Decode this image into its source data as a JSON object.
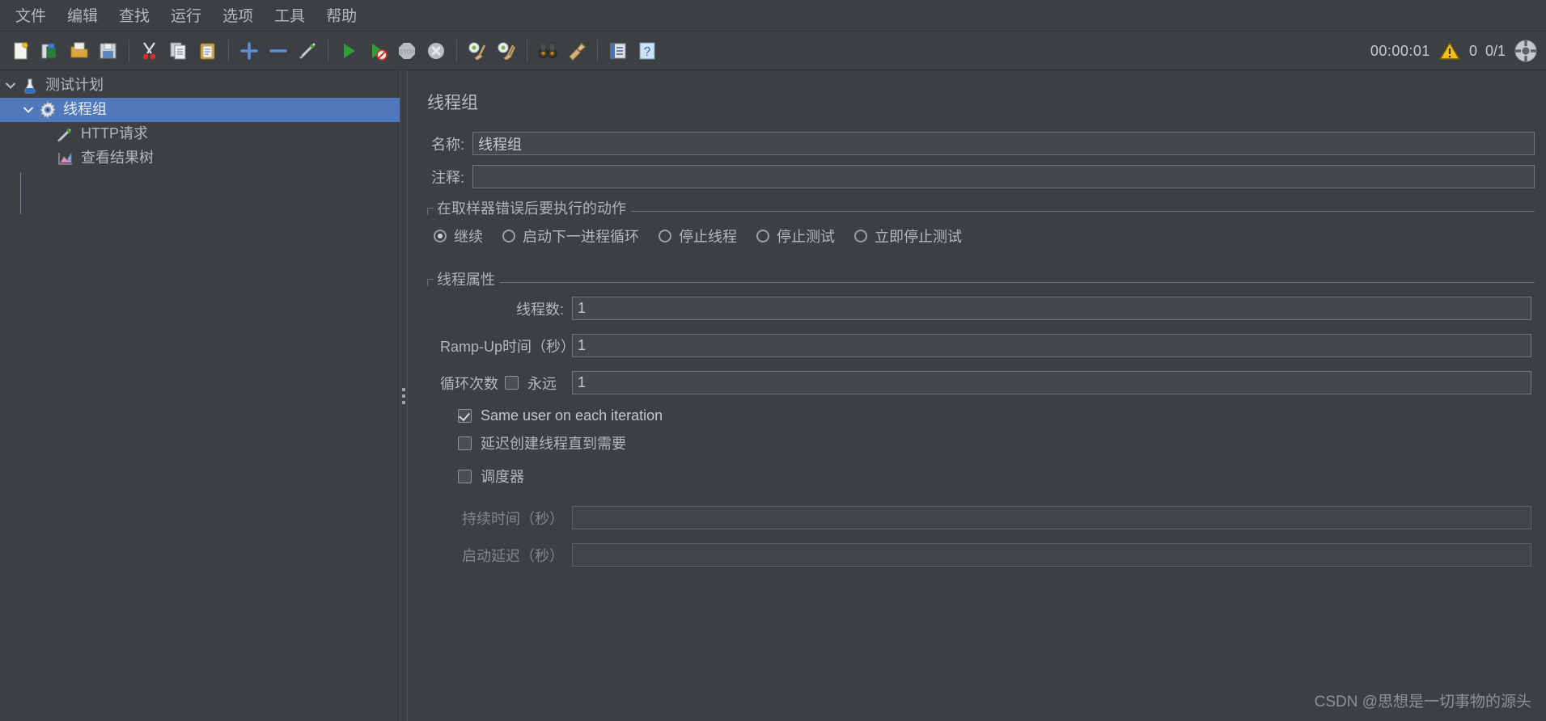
{
  "window": {
    "theme_bg": "#3c4043",
    "accent_selection": "#5079bd",
    "text_color": "#b5b8ba"
  },
  "menubar": {
    "items": [
      {
        "label": "文件",
        "name": "menu-file"
      },
      {
        "label": "编辑",
        "name": "menu-edit"
      },
      {
        "label": "查找",
        "name": "menu-search"
      },
      {
        "label": "运行",
        "name": "menu-run"
      },
      {
        "label": "选项",
        "name": "menu-options"
      },
      {
        "label": "工具",
        "name": "menu-tools"
      },
      {
        "label": "帮助",
        "name": "menu-help"
      }
    ]
  },
  "toolbar": {
    "icons": [
      "new-document-icon",
      "templates-icon",
      "open-folder-icon",
      "save-disk-icon",
      "cut-scissors-icon",
      "copy-icon",
      "paste-clipboard-icon",
      "add-plus-icon",
      "remove-minus-icon",
      "toggle-pen-icon",
      "start-play-icon",
      "start-no-pauses-icon",
      "stop-icon",
      "shutdown-icon",
      "clear-gear-icon",
      "clear-all-gear-icon",
      "search-binoculars-icon",
      "reset-search-icon",
      "function-helper-icon",
      "help-icon"
    ],
    "status": {
      "timer": "00:00:01",
      "warning_icon": "warning-triangle-icon",
      "warning_count": "0",
      "threads_running": "0/1",
      "threads_icon": "thread-status-icon",
      "warning_color": "#f2c11a"
    }
  },
  "tree": {
    "nodes": [
      {
        "label": "测试计划",
        "icon": "test-plan-flask-icon",
        "name": "tree-node-test-plan",
        "depth": 0,
        "expanded": true,
        "selected": false
      },
      {
        "label": "线程组",
        "icon": "thread-group-gear-icon",
        "name": "tree-node-thread-group",
        "depth": 1,
        "expanded": true,
        "selected": true
      },
      {
        "label": "HTTP请求",
        "icon": "http-request-pen-icon",
        "name": "tree-node-http-request",
        "depth": 2,
        "expanded": false,
        "selected": false
      },
      {
        "label": "查看结果树",
        "icon": "view-results-tree-icon",
        "name": "tree-node-view-results-tree",
        "depth": 2,
        "expanded": false,
        "selected": false
      }
    ]
  },
  "panel": {
    "title": "线程组",
    "name_label": "名称:",
    "name_value": "线程组",
    "comment_label": "注释:",
    "comment_value": "",
    "comment_placeholder": "",
    "error_action": {
      "group_title": "在取样器错误后要执行的动作",
      "options": [
        {
          "label": "继续",
          "name": "radio-continue",
          "selected": true
        },
        {
          "label": "启动下一进程循环",
          "name": "radio-start-next-loop",
          "selected": false
        },
        {
          "label": "停止线程",
          "name": "radio-stop-thread",
          "selected": false
        },
        {
          "label": "停止测试",
          "name": "radio-stop-test",
          "selected": false
        },
        {
          "label": "立即停止测试",
          "name": "radio-stop-test-now",
          "selected": false
        }
      ]
    },
    "thread_properties": {
      "group_title": "线程属性",
      "num_threads_label": "线程数:",
      "num_threads_value": "1",
      "ramp_up_label": "Ramp-Up时间（秒）:",
      "ramp_up_value": "1",
      "loop_count_label": "循环次数",
      "loop_forever_label": "永远",
      "loop_forever_checked": false,
      "loop_count_value": "1",
      "same_user_label": "Same user on each iteration",
      "same_user_checked": true,
      "delay_thread_label": "延迟创建线程直到需要",
      "delay_thread_checked": false,
      "scheduler_label": "调度器",
      "scheduler_checked": false,
      "duration_label": "持续时间（秒）",
      "duration_value": "",
      "duration_enabled": false,
      "startup_delay_label": "启动延迟（秒）",
      "startup_delay_value": "",
      "startup_delay_enabled": false
    }
  },
  "watermark": {
    "text": "CSDN @思想是一切事物的源头"
  }
}
